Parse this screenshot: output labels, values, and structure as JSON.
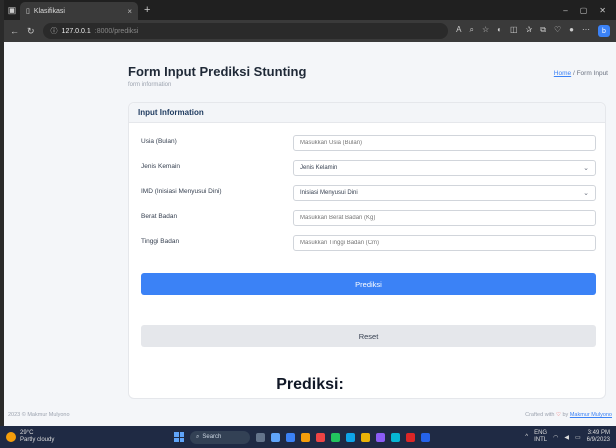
{
  "browser": {
    "tab_title": "Klasifikasi",
    "tab_close": "×",
    "new_tab": "+",
    "url_host": "127.0.0.1",
    "url_path": ":8000/prediksi",
    "win_min": "–",
    "win_max": "▢",
    "win_close": "✕"
  },
  "page": {
    "title": "Form Input Prediksi Stunting",
    "subtitle": "form information",
    "breadcrumb_home": "Home",
    "breadcrumb_sep": " / ",
    "breadcrumb_current": "Form Input"
  },
  "card": {
    "header": "Input Information",
    "fields": [
      {
        "label": "Usia (Bulan)",
        "placeholder": "Masukkan Usia (Bulan)"
      },
      {
        "label": "Jenis Kemain",
        "value": "Jenis Kelamin"
      },
      {
        "label": "IMD (Inisiasi Menyusui Dini)",
        "value": "Inisiasi Menyusui Dini"
      },
      {
        "label": "Berat Badan",
        "placeholder": "Masukkan Berat Badan (Kg)"
      },
      {
        "label": "Tinggi Badan",
        "placeholder": "Masukkan Tinggi Badan (Cm)"
      }
    ],
    "submit_label": "Prediksi",
    "reset_label": "Reset"
  },
  "result": {
    "title": "Prediksi:"
  },
  "footer": {
    "copyright": "2023 © Makmur Mulyono",
    "crafted_prefix": "Crafted with ",
    "crafted_by": " by ",
    "author": "Makmur Mulyono"
  },
  "taskbar": {
    "temp": "29°C",
    "weather": "Partly cloudy",
    "search": "Search",
    "lang1": "ENG",
    "lang2": "INTL",
    "time": "3:49 PM",
    "date": "6/9/2023"
  },
  "colors": {
    "accent": "#3b82f6",
    "reset_bg": "#e5e7eb",
    "taskbar": "#1f2a44"
  }
}
